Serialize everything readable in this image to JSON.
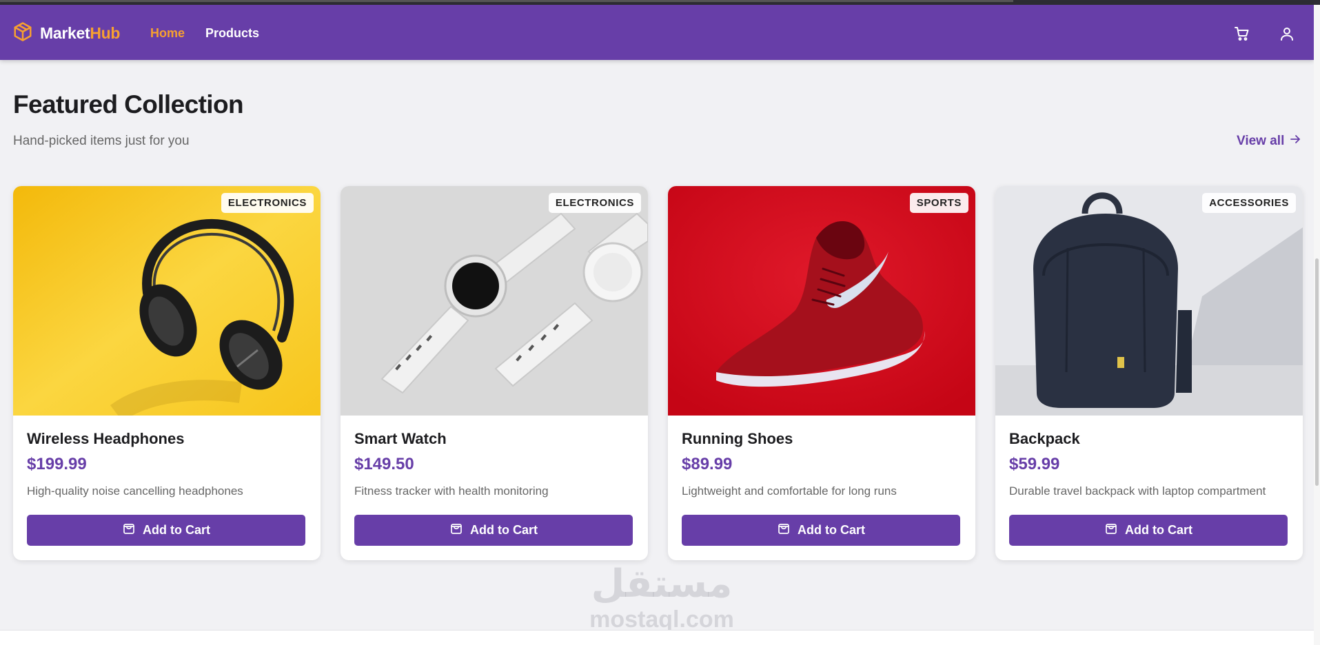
{
  "brand": {
    "name_part1": "Market",
    "name_part2": "Hub",
    "logo": "box-icon"
  },
  "nav": {
    "links": [
      {
        "label": "Home",
        "active": true
      },
      {
        "label": "Products",
        "active": false
      }
    ],
    "icons": [
      "cart-icon",
      "user-icon"
    ]
  },
  "section": {
    "title": "Featured Collection",
    "subtitle": "Hand-picked items just for you",
    "view_all": "View all"
  },
  "products": [
    {
      "category": "ELECTRONICS",
      "name": "Wireless Headphones",
      "price": "$199.99",
      "description": "High-quality noise cancelling headphones",
      "button": "Add to Cart",
      "image_bg": "#f6c40f"
    },
    {
      "category": "ELECTRONICS",
      "name": "Smart Watch",
      "price": "$149.50",
      "description": "Fitness tracker with health monitoring",
      "button": "Add to Cart",
      "image_bg": "#d9d9d9"
    },
    {
      "category": "SPORTS",
      "name": "Running Shoes",
      "price": "$89.99",
      "description": "Lightweight and comfortable for long runs",
      "button": "Add to Cart",
      "image_bg": "#d0061a"
    },
    {
      "category": "ACCESSORIES",
      "name": "Backpack",
      "price": "$59.99",
      "description": "Durable travel backpack with laptop compartment",
      "button": "Add to Cart",
      "image_bg": "#e4e6ea"
    }
  ],
  "watermark": {
    "logo_text": "مستقل",
    "text": "mostaql.com"
  },
  "colors": {
    "primary": "#673ea8",
    "accent": "#f7a030",
    "background": "#f1f1f4"
  }
}
